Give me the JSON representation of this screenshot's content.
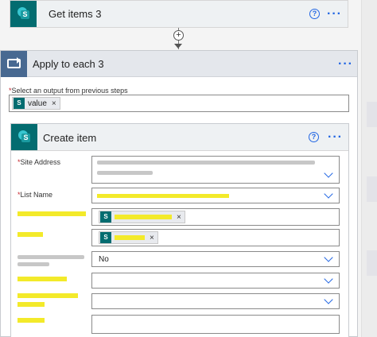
{
  "get_items_card": {
    "title": "Get items 3",
    "icon": "sharepoint-icon",
    "help_glyph": "?",
    "menu_glyph": "···"
  },
  "connector": {
    "plus_glyph": "+"
  },
  "apply_to_each": {
    "title": "Apply to each 3",
    "icon": "loop-icon",
    "menu_glyph": "···",
    "select_label": "Select an output from previous steps",
    "required_mark": "*",
    "token": {
      "label": "value",
      "remove_glyph": "×",
      "icon": "sharepoint-icon"
    }
  },
  "create_item": {
    "title": "Create item",
    "icon": "sharepoint-icon",
    "help_glyph": "?",
    "menu_glyph": "···",
    "fields": {
      "site_address": {
        "label": "Site Address",
        "required_mark": "*"
      },
      "list_name": {
        "label": "List Name",
        "required_mark": "*"
      },
      "field_5": {
        "value": "No"
      },
      "token_remove_glyph": "×"
    }
  },
  "colors": {
    "sharepoint_teal": "#036c70",
    "loop_blue": "#486991",
    "accent_blue": "#2266e3",
    "required_red": "#c4262e",
    "redaction_yellow": "#f3ea2a"
  }
}
